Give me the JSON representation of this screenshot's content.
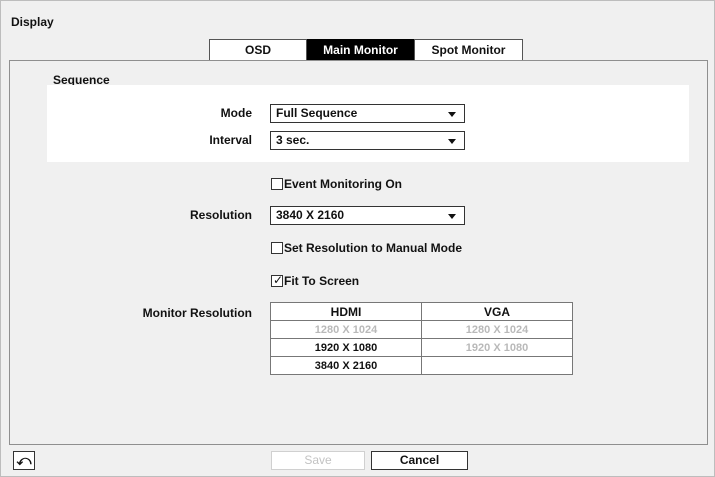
{
  "window": {
    "title": "Display"
  },
  "tabs": [
    {
      "label": "OSD"
    },
    {
      "label": "Main Monitor"
    },
    {
      "label": "Spot Monitor"
    }
  ],
  "sequence": {
    "section_label": "Sequence",
    "mode_label": "Mode",
    "mode_value": "Full Sequence",
    "interval_label": "Interval",
    "interval_value": "3 sec."
  },
  "event_monitoring": {
    "label": "Event Monitoring On",
    "checked": false
  },
  "resolution": {
    "label": "Resolution",
    "value": "3840 X 2160"
  },
  "manual_mode": {
    "label": "Set Resolution to Manual Mode",
    "checked": false
  },
  "fit_to_screen": {
    "label": "Fit To Screen",
    "checked": true
  },
  "monitor_resolution": {
    "label": "Monitor Resolution",
    "columns": [
      "HDMI",
      "VGA"
    ],
    "rows": [
      [
        "1280 X 1024",
        "1280 X 1024"
      ],
      [
        "1920 X 1080",
        "1920 X 1080"
      ],
      [
        "3840 X 2160",
        ""
      ]
    ]
  },
  "footer": {
    "back_icon": "undo-arrow-icon",
    "save_label": "Save",
    "cancel_label": "Cancel"
  }
}
